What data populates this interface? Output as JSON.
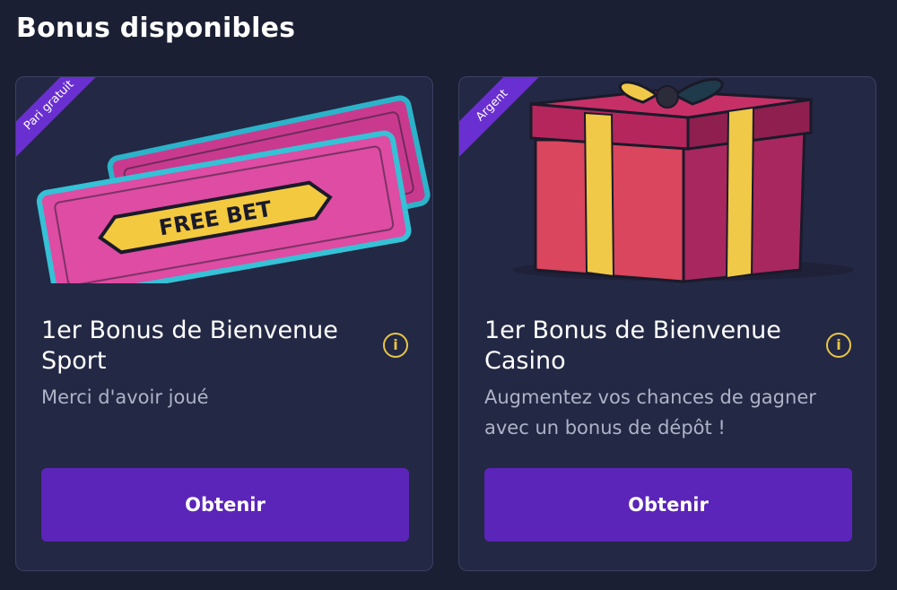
{
  "header": {
    "title": "Bonus disponibles"
  },
  "cards": [
    {
      "badge": "Pari gratuit",
      "image_text": "FREE BET",
      "title": "1er Bonus de Bienvenue Sport",
      "description": "Merci d'avoir joué",
      "button_label": "Obtenir",
      "icon": "info-icon"
    },
    {
      "badge": "Argent",
      "title": "1er Bonus de Bienvenue Casino",
      "description": "Augmentez vos chances de gagner avec un bonus de dépôt !",
      "button_label": "Obtenir",
      "icon": "info-icon"
    }
  ],
  "colors": {
    "background": "#1b1f33",
    "card": "#232844",
    "button": "#5a25b8",
    "badge": "#6a2fd0",
    "info_icon": "#e8c547"
  }
}
